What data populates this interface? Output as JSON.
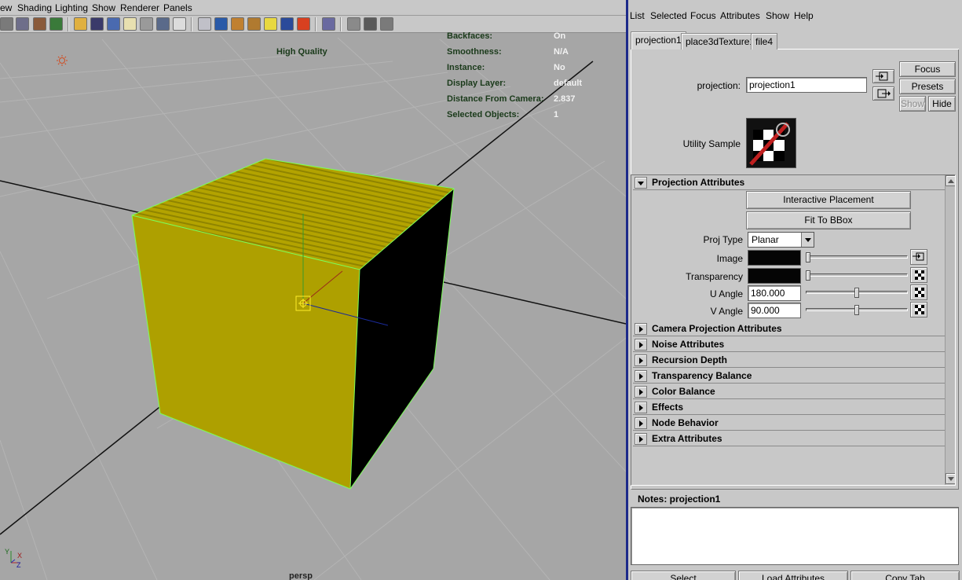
{
  "viewport": {
    "menu": [
      "ew",
      "Shading",
      "Lighting",
      "Show",
      "Renderer",
      "Panels"
    ],
    "quality_label": "High Quality",
    "camera_name": "persp",
    "hud": [
      {
        "label": "Backfaces:",
        "value": "On"
      },
      {
        "label": "Smoothness:",
        "value": "N/A"
      },
      {
        "label": "Instance:",
        "value": "No"
      },
      {
        "label": "Display Layer:",
        "value": "default"
      },
      {
        "label": "Distance From Camera:",
        "value": "2.837"
      },
      {
        "label": "Selected Objects:",
        "value": "1"
      }
    ],
    "axis_labels": {
      "x": "X",
      "y": "Y",
      "z": "Z"
    },
    "colors": {
      "background": "#a6a6a6",
      "cube_face": "#b0a300",
      "cube_wireframe": "#7cff5a",
      "grid_axis": "#111111"
    }
  },
  "attribute_editor": {
    "menu": [
      "List",
      "Selected",
      "Focus",
      "Attributes",
      "Show",
      "Help"
    ],
    "tabs": [
      {
        "label": "projection1",
        "active": true
      },
      {
        "label": "place3dTexture1",
        "active": false
      },
      {
        "label": "file4",
        "active": false
      }
    ],
    "node_label": "projection:",
    "node_name": "projection1",
    "buttons": {
      "focus": "Focus",
      "presets": "Presets",
      "show": "Show",
      "hide": "Hide"
    },
    "sample_label": "Utility Sample",
    "projection_section": {
      "title": "Projection Attributes",
      "interactive_placement": "Interactive Placement",
      "fit_to_bbox": "Fit To BBox",
      "proj_type_label": "Proj Type",
      "proj_type_value": "Planar",
      "image_label": "Image",
      "transparency_label": "Transparency",
      "u_angle_label": "U Angle",
      "u_angle_value": "180.000",
      "v_angle_label": "V Angle",
      "v_angle_value": "90.000",
      "image_slider_level": 0.0,
      "transparency_slider_level": 0.0,
      "u_angle_slider_level": 0.5,
      "v_angle_slider_level": 0.5
    },
    "collapsed_sections": [
      "Camera Projection Attributes",
      "Noise Attributes",
      "Recursion Depth",
      "Transparency Balance",
      "Color Balance",
      "Effects",
      "Node Behavior",
      "Extra Attributes"
    ],
    "notes_label": "Notes:  projection1",
    "notes_text": "",
    "bottom_buttons": [
      "Select",
      "Load Attributes",
      "Copy Tab"
    ]
  }
}
